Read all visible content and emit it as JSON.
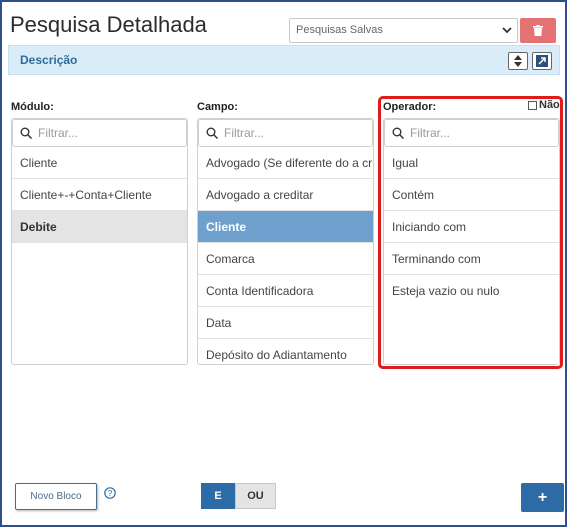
{
  "header": {
    "title": "Pesquisa Detalhada",
    "saved_searches": {
      "value": "Pesquisas Salvas"
    }
  },
  "description_bar": {
    "label": "Descrição"
  },
  "modulo": {
    "label": "Módulo:",
    "filter_placeholder": "Filtrar...",
    "items": [
      {
        "label": "Cliente"
      },
      {
        "label": "Cliente+-+Conta+Cliente"
      },
      {
        "label": "Debite"
      }
    ]
  },
  "campo": {
    "label": "Campo:",
    "filter_placeholder": "Filtrar...",
    "items": [
      {
        "label": "Advogado (Se diferente do a cr"
      },
      {
        "label": "Advogado a creditar"
      },
      {
        "label": "Cliente"
      },
      {
        "label": "Comarca"
      },
      {
        "label": "Conta Identificadora"
      },
      {
        "label": "Data"
      },
      {
        "label": "Depósito do Adiantamento"
      }
    ]
  },
  "operador": {
    "label": "Operador:",
    "nao_label": "Não",
    "filter_placeholder": "Filtrar...",
    "items": [
      {
        "label": "Igual"
      },
      {
        "label": "Contém"
      },
      {
        "label": "Iniciando com"
      },
      {
        "label": "Terminando com"
      },
      {
        "label": "Esteja vazio ou nulo"
      }
    ]
  },
  "footer": {
    "novo_bloco": "Novo Bloco",
    "and_label": "E",
    "or_label": "OU",
    "add_label": "+"
  },
  "colors": {
    "accent": "#2d6ba6",
    "selected_blue": "#6fa0cd",
    "highlight_red": "#e01b1b",
    "delete_red": "#e57373",
    "desc_bg": "#d9ecf7"
  }
}
